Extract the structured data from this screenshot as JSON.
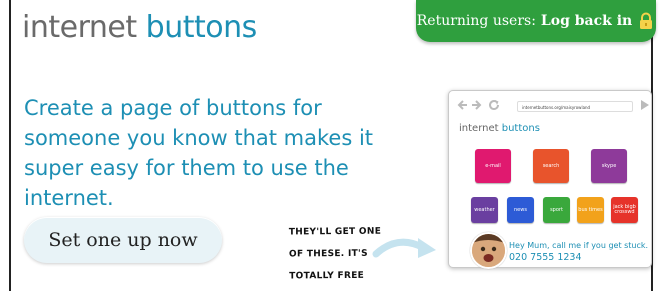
{
  "header": {
    "logo_word1": "internet",
    "logo_word2": "buttons",
    "login_prefix": "Returning users:",
    "login_action": "Log back in"
  },
  "hero": {
    "headline": "Create a page of buttons for someone you know that makes it super easy for them to use the internet.",
    "cta_label": "Set one up now",
    "note_lines": [
      "THEY'LL GET ONE",
      "OF THESE. IT'S",
      "TOTALLY FREE"
    ]
  },
  "preview": {
    "url": "internetbuttons.org/maisyrowland",
    "logo_word1": "internet",
    "logo_word2": "buttons",
    "big_buttons": [
      {
        "label": "e-mail",
        "color": "#e0196f"
      },
      {
        "label": "search",
        "color": "#e8542c"
      },
      {
        "label": "skype",
        "color": "#8e3a9a"
      }
    ],
    "small_buttons": [
      {
        "label": "weather",
        "color": "#6a3fa0"
      },
      {
        "label": "news",
        "color": "#2d5bd6"
      },
      {
        "label": "sport",
        "color": "#3aa83c"
      },
      {
        "label": "bus times",
        "color": "#f2a21b"
      },
      {
        "label": "jack bigb crosswd",
        "color": "#e6332a"
      }
    ],
    "message_line1": "Hey Mum, call me if you get stuck.",
    "message_line2": "020 7555 1234"
  },
  "colors": {
    "brand_blue": "#1d8fb4",
    "login_green": "#2f9f3e"
  }
}
